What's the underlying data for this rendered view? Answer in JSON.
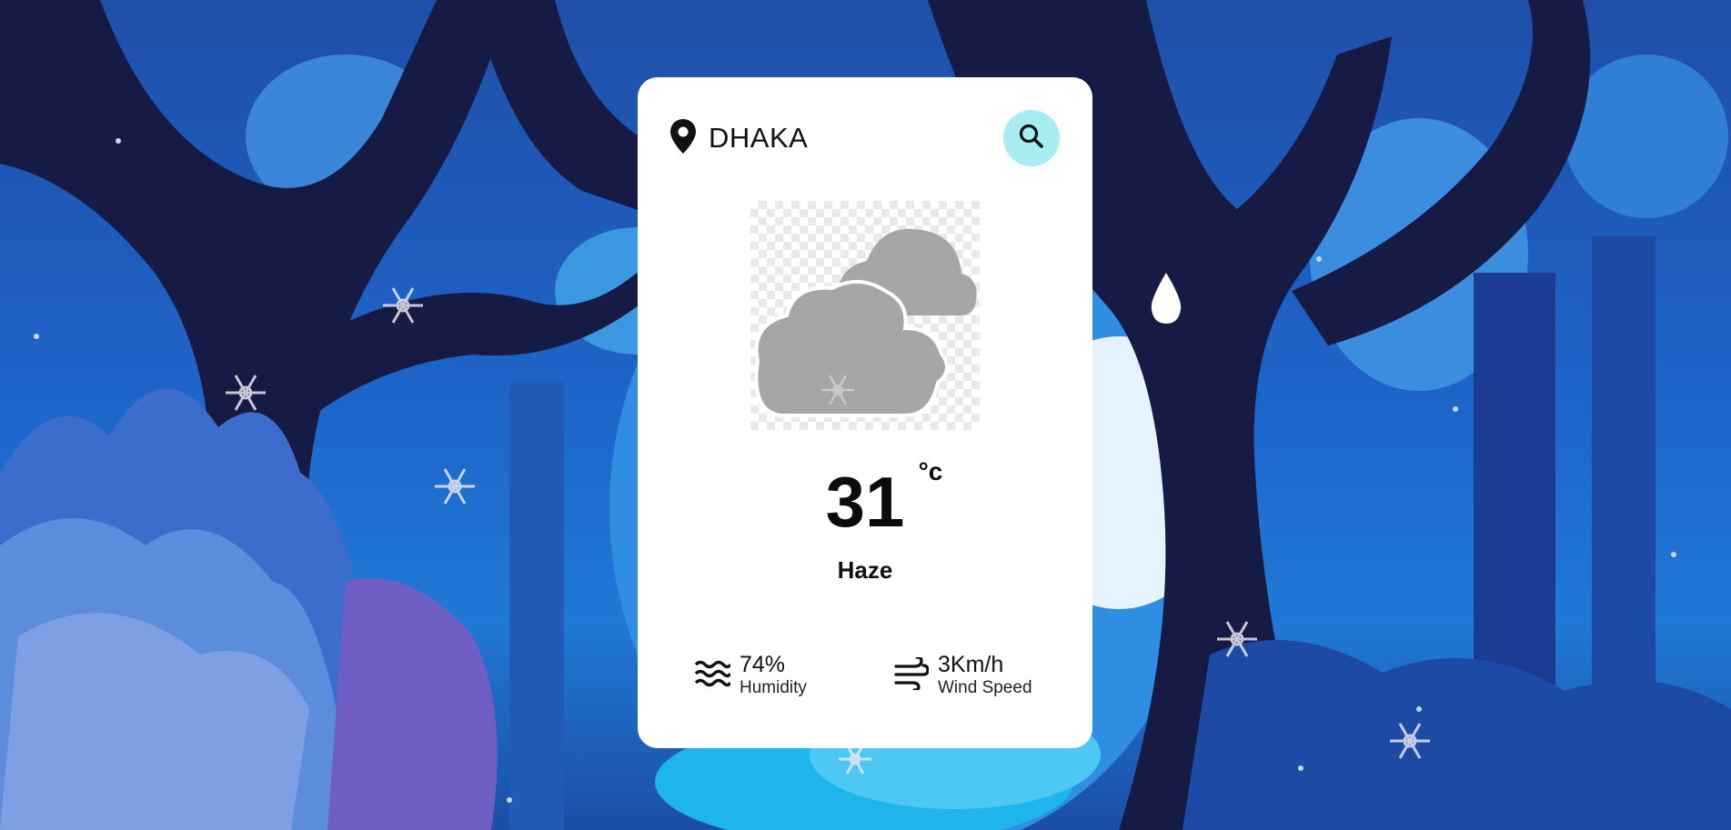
{
  "location": {
    "icon": "map-pin-icon",
    "name": "DHAKA"
  },
  "search": {
    "icon": "search-icon",
    "button_color": "#a6ecf1"
  },
  "weather": {
    "icon": "clouds-icon",
    "temperature": "31",
    "unit": "°c",
    "condition": "Haze"
  },
  "stats": {
    "humidity": {
      "icon": "humidity-waves-icon",
      "value": "74%",
      "label": "Humidity"
    },
    "wind": {
      "icon": "wind-icon",
      "value": "3Km/h",
      "label": "Wind Speed"
    }
  },
  "colors": {
    "card_background": "#ffffff",
    "background_primary": "#1e63c8",
    "background_dark": "#161b45"
  }
}
